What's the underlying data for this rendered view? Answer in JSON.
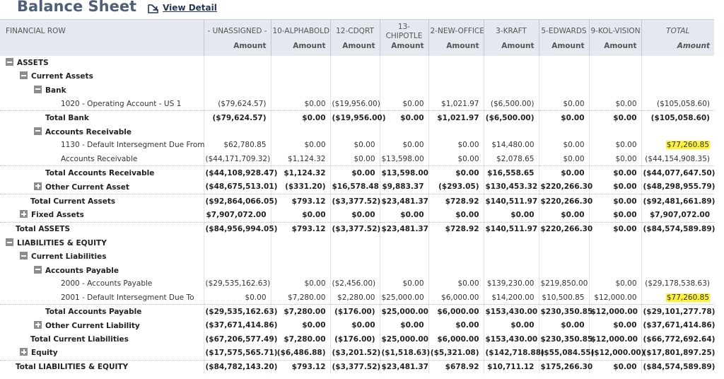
{
  "header": {
    "title": "Balance Sheet",
    "view_detail_label": "View Detail",
    "view_detail_icon": "external-link-arrow-icon"
  },
  "columns": {
    "first": "FINANCIAL ROW",
    "names": [
      "- UNASSIGNED -",
      "10-ALPHABOLD",
      "12-CDQRT",
      "13-\nCHIPOTLE",
      "2-NEW-OFFICE",
      "3-KRAFT",
      "5-EDWARDS",
      "9-KOL-VISION",
      "TOTAL"
    ],
    "sub_label": "Amount"
  },
  "highlight_color": "#fff23a",
  "rows": [
    {
      "label": "ASSETS",
      "type": "section",
      "toggle": "minus",
      "level": 0,
      "values": []
    },
    {
      "label": "Current Assets",
      "type": "section",
      "toggle": "minus",
      "level": 1,
      "values": []
    },
    {
      "label": "Bank",
      "type": "section",
      "toggle": "minus",
      "level": 2,
      "values": []
    },
    {
      "label": "1020 - Operating Account - US 1",
      "type": "account",
      "level": 3,
      "values": [
        "($79,624.57)",
        "$0.00",
        "($19,956.00)",
        "$0.00",
        "$1,021.97",
        "($6,500.00)",
        "$0.00",
        "$0.00",
        "($105,058.60)"
      ]
    },
    {
      "label": "Total Bank",
      "type": "total",
      "level": 2,
      "values": [
        "($79,624.57)",
        "$0.00",
        "($19,956.00)",
        "$0.00",
        "$1,021.97",
        "($6,500.00)",
        "$0.00",
        "$0.00",
        "($105,058.60)"
      ]
    },
    {
      "label": "Accounts Receivable",
      "type": "section",
      "toggle": "minus",
      "level": 2,
      "values": []
    },
    {
      "label": "1130 - Default Intersegment Due From",
      "type": "account",
      "level": 3,
      "values": [
        "$62,780.85",
        "$0.00",
        "$0.00",
        "$0.00",
        "$0.00",
        "$14,480.00",
        "$0.00",
        "$0.00",
        "$77,260.85"
      ],
      "highlight_total": true
    },
    {
      "label": "Accounts Receivable",
      "type": "account",
      "level": 3,
      "values": [
        "($44,171,709.32)",
        "$1,124.32",
        "$0.00",
        "$13,598.00",
        "$0.00",
        "$2,078.65",
        "$0.00",
        "$0.00",
        "($44,154,908.35)"
      ]
    },
    {
      "label": "Total Accounts Receivable",
      "type": "total",
      "level": 2,
      "values": [
        "($44,108,928.47)",
        "$1,124.32",
        "$0.00",
        "$13,598.00",
        "$0.00",
        "$16,558.65",
        "$0.00",
        "$0.00",
        "($44,077,647.50)"
      ]
    },
    {
      "label": "Other Current Asset",
      "type": "collapsed",
      "toggle": "plus",
      "level": 2,
      "values": [
        "($48,675,513.01)",
        "($331.20)",
        "$16,578.48",
        "$9,883.37",
        "($293.05)",
        "$130,453.32",
        "$220,266.30",
        "$0.00",
        "($48,298,955.79)"
      ]
    },
    {
      "label": "Total Current Assets",
      "type": "total",
      "level": 1,
      "values": [
        "($92,864,066.05)",
        "$793.12",
        "($3,377.52)",
        "$23,481.37",
        "$728.92",
        "$140,511.97",
        "$220,266.30",
        "$0.00",
        "($92,481,661.89)"
      ]
    },
    {
      "label": "Fixed Assets",
      "type": "collapsed",
      "toggle": "plus",
      "level": 1,
      "values": [
        "$7,907,072.00",
        "$0.00",
        "$0.00",
        "$0.00",
        "$0.00",
        "$0.00",
        "$0.00",
        "$0.00",
        "$7,907,072.00"
      ]
    },
    {
      "label": "Total ASSETS",
      "type": "total",
      "level": 0,
      "values": [
        "($84,956,994.05)",
        "$793.12",
        "($3,377.52)",
        "$23,481.37",
        "$728.92",
        "$140,511.97",
        "$220,266.30",
        "$0.00",
        "($84,574,589.89)"
      ]
    },
    {
      "label": "LIABILITIES & EQUITY",
      "type": "section",
      "toggle": "minus",
      "level": 0,
      "values": []
    },
    {
      "label": "Current Liabilities",
      "type": "section",
      "toggle": "minus",
      "level": 1,
      "values": []
    },
    {
      "label": "Accounts Payable",
      "type": "section",
      "toggle": "minus",
      "level": 2,
      "values": []
    },
    {
      "label": "2000 - Accounts Payable",
      "type": "account",
      "level": 3,
      "values": [
        "($29,535,162.63)",
        "$0.00",
        "($2,456.00)",
        "$0.00",
        "$0.00",
        "$139,230.00",
        "$219,850.00",
        "$0.00",
        "($29,178,538.63)"
      ]
    },
    {
      "label": "2001 - Default Intersegment Due To",
      "type": "account",
      "level": 3,
      "values": [
        "$0.00",
        "$7,280.00",
        "$2,280.00",
        "$25,000.00",
        "$6,000.00",
        "$14,200.00",
        "$10,500.85",
        "$12,000.00",
        "$77,260.85"
      ],
      "highlight_total": true
    },
    {
      "label": "Total Accounts Payable",
      "type": "total",
      "level": 2,
      "values": [
        "($29,535,162.63)",
        "$7,280.00",
        "($176.00)",
        "$25,000.00",
        "$6,000.00",
        "$153,430.00",
        "$230,350.85",
        "$12,000.00",
        "($29,101,277.78)"
      ]
    },
    {
      "label": "Other Current Liability",
      "type": "collapsed",
      "toggle": "plus",
      "level": 2,
      "values": [
        "($37,671,414.86)",
        "$0.00",
        "$0.00",
        "$0.00",
        "$0.00",
        "$0.00",
        "$0.00",
        "$0.00",
        "($37,671,414.86)"
      ]
    },
    {
      "label": "Total Current Liabilities",
      "type": "total",
      "level": 1,
      "values": [
        "($67,206,577.49)",
        "$7,280.00",
        "($176.00)",
        "$25,000.00",
        "$6,000.00",
        "$153,430.00",
        "$230,350.85",
        "$12,000.00",
        "($66,772,692.64)"
      ]
    },
    {
      "label": "Equity",
      "type": "collapsed",
      "toggle": "plus",
      "level": 1,
      "values": [
        "($17,575,565.71)",
        "($6,486.88)",
        "($3,201.52)",
        "($1,518.63)",
        "($5,321.08)",
        "($142,718.88)",
        "($55,084.55)",
        "($12,000.00)",
        "($17,801,897.25)"
      ]
    },
    {
      "label": "Total LIABILITIES & EQUITY",
      "type": "total",
      "level": 0,
      "values": [
        "($84,782,143.20)",
        "$793.12",
        "($3,377.52)",
        "$23,481.37",
        "$678.92",
        "$10,711.12",
        "$175,266.30",
        "$0.00",
        "($84,574,589.89)"
      ]
    }
  ]
}
